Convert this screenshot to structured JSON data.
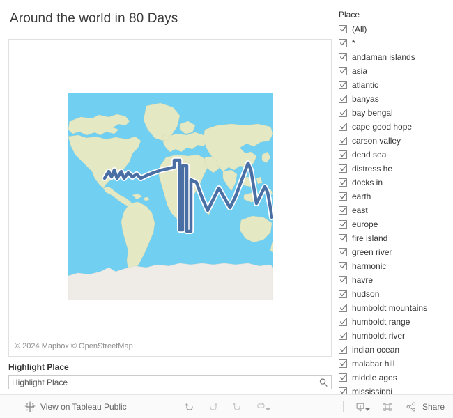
{
  "dashboard": {
    "title": "Around the world in 80 Days"
  },
  "map": {
    "attribution": "© 2024 Mapbox  © OpenStreetMap",
    "ocean_color": "#71cff2",
    "land_color": "#e4e8c3",
    "antarctica_color": "#efebe6",
    "route_color": "#4a6fa5",
    "route_halo_color": "#ffffff"
  },
  "highlight_filter": {
    "label": "Highlight Place",
    "placeholder": "Highlight Place",
    "value": "",
    "icon": "search-icon"
  },
  "place_filter": {
    "title": "Place",
    "items": [
      {
        "label": "(All)",
        "checked": true
      },
      {
        "label": "*",
        "checked": true
      },
      {
        "label": "andaman islands",
        "checked": true
      },
      {
        "label": "asia",
        "checked": true
      },
      {
        "label": "atlantic",
        "checked": true
      },
      {
        "label": "banyas",
        "checked": true
      },
      {
        "label": "bay bengal",
        "checked": true
      },
      {
        "label": "cape good hope",
        "checked": true
      },
      {
        "label": "carson valley",
        "checked": true
      },
      {
        "label": "dead sea",
        "checked": true
      },
      {
        "label": "distress he",
        "checked": true
      },
      {
        "label": "docks in",
        "checked": true
      },
      {
        "label": "earth",
        "checked": true
      },
      {
        "label": "east",
        "checked": true
      },
      {
        "label": "europe",
        "checked": true
      },
      {
        "label": "fire island",
        "checked": true
      },
      {
        "label": "green river",
        "checked": true
      },
      {
        "label": "harmonic",
        "checked": true
      },
      {
        "label": "havre",
        "checked": true
      },
      {
        "label": "hudson",
        "checked": true
      },
      {
        "label": "humboldt mountains",
        "checked": true
      },
      {
        "label": "humboldt range",
        "checked": true
      },
      {
        "label": "humboldt river",
        "checked": true
      },
      {
        "label": "indian ocean",
        "checked": true
      },
      {
        "label": "malabar hill",
        "checked": true
      },
      {
        "label": "middle ages",
        "checked": true
      },
      {
        "label": "mississippi",
        "checked": true
      }
    ]
  },
  "toolbar": {
    "brand_label": "View on Tableau Public",
    "brand_icon": "tableau-logo-icon",
    "undo_icon": "undo-icon",
    "redo_icon": "redo-icon",
    "revert_icon": "revert-icon",
    "refresh_icon": "refresh-icon",
    "refresh_caret_icon": "chevron-down-icon",
    "download_icon": "download-icon",
    "download_caret_icon": "chevron-down-icon",
    "fullscreen_icon": "fullscreen-icon",
    "share_icon": "share-icon",
    "share_label": "Share"
  }
}
